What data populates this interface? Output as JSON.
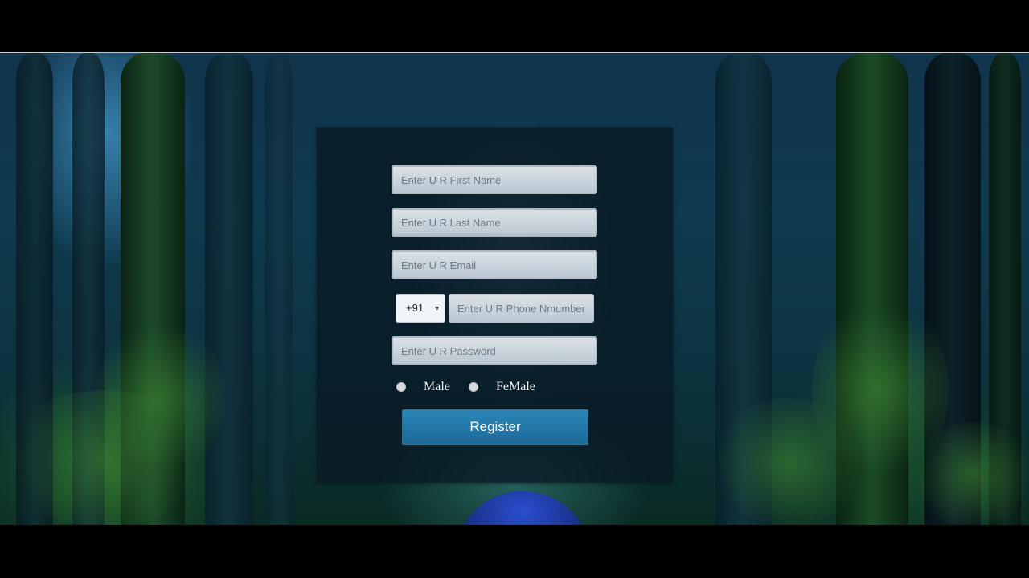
{
  "form": {
    "first_name": {
      "placeholder": "Enter U R First Name",
      "value": ""
    },
    "last_name": {
      "placeholder": "Enter U R Last Name",
      "value": ""
    },
    "email": {
      "placeholder": "Enter U R Email",
      "value": ""
    },
    "country_code": {
      "selected": "+91",
      "icon": "chevron-down-icon"
    },
    "phone": {
      "placeholder": "Enter U R Phone Nmumber",
      "value": ""
    },
    "password": {
      "placeholder": "Enter U R Password",
      "value": ""
    },
    "gender": {
      "options": [
        {
          "label": "Male",
          "checked": false
        },
        {
          "label": "FeMale",
          "checked": false
        }
      ]
    },
    "register_label": "Register"
  },
  "colors": {
    "button": "#2176a8",
    "panel": "#081822",
    "input_bg": "#e8eef3"
  }
}
